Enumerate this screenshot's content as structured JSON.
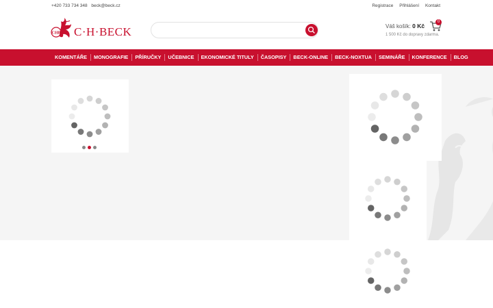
{
  "topbar": {
    "phone": "+420 733 734 348",
    "email": "beck@beck.cz",
    "links": [
      "Registrace",
      "Přihlášení",
      "Kontakt"
    ]
  },
  "header": {
    "logo_text": "C·H·BECK",
    "logo_monogram": "CHB",
    "search_placeholder": "",
    "cart_label": "Váš košík:",
    "cart_value": "0 Kč",
    "cart_count": "0",
    "cart_sub": "1 500 Kč do dopravy zdarma."
  },
  "nav": {
    "items": [
      "KOMENTÁŘE",
      "MONOGRAFIE",
      "PŘÍRUČKY",
      "UČEBNICE",
      "EKONOMICKÉ TITULY",
      "ČASOPISY",
      "BECK-ONLINE",
      "BECK-NOXTUA",
      "SEMINÁŘE",
      "KONFERENCE",
      "BLOG"
    ]
  },
  "colors": {
    "brand": "#c8102e",
    "page_bg": "#f5f5f5"
  },
  "icons": [
    "search-icon",
    "cart-icon",
    "loading-spinner-icon",
    "griffin-logo-icon"
  ]
}
